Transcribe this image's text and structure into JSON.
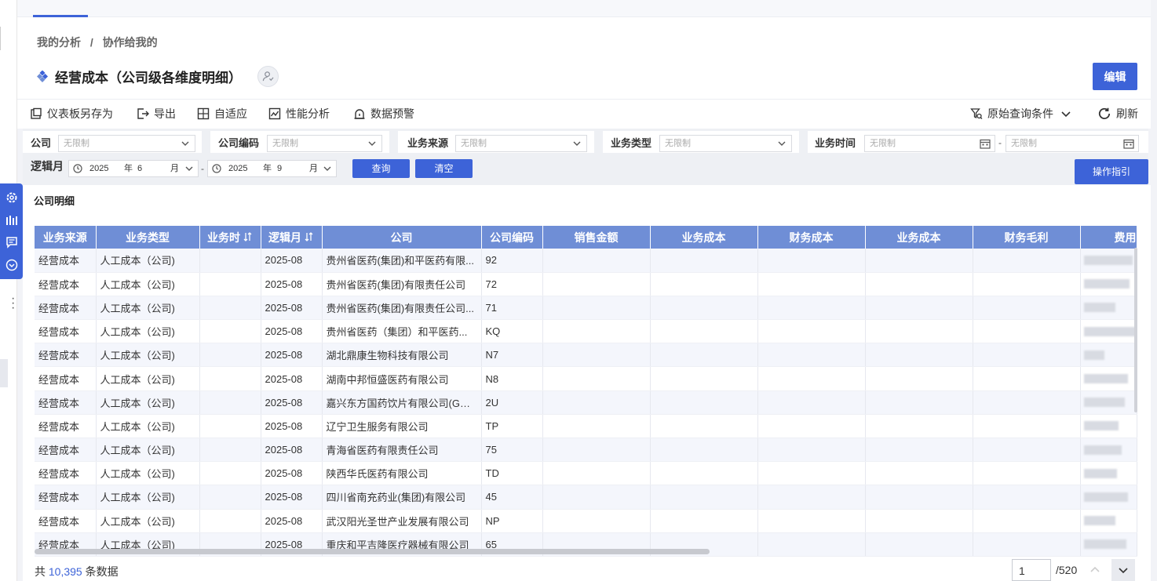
{
  "breadcrumb": {
    "root": "我的分析",
    "separator": "/",
    "current": "协作给我的"
  },
  "page_title": "经营成本（公司级各维度明细）",
  "edit_label": "编辑",
  "toolbar": {
    "save_as": "仪表板另存为",
    "export": "导出",
    "adaptive": "自适应",
    "performance": "性能分析",
    "alert": "数据预警",
    "original_query": "原始查询条件",
    "refresh": "刷新"
  },
  "filters": {
    "company": {
      "label": "公司",
      "value": "无限制"
    },
    "company_code": {
      "label": "公司编码",
      "value": "无限制"
    },
    "biz_source": {
      "label": "业务来源",
      "value": "无限制"
    },
    "biz_type": {
      "label": "业务类型",
      "value": "无限制"
    },
    "biz_time": {
      "label": "业务时间",
      "start": "无限制",
      "sep": "-",
      "end": "无限制"
    },
    "logic_month": {
      "label": "逻辑月",
      "start_year": "2025",
      "start_year_unit": "年",
      "start_month": "6",
      "start_month_unit": "月",
      "sep": "-",
      "end_year": "2025",
      "end_year_unit": "年",
      "end_month": "9",
      "end_month_unit": "月"
    },
    "query_label": "查询",
    "clear_label": "清空",
    "guide_label": "操作指引"
  },
  "panel_title": "公司明细",
  "table": {
    "columns": [
      "业务来源",
      "业务类型",
      "业务时",
      "逻辑月",
      "公司",
      "公司编码",
      "销售金额",
      "业务成本",
      "财务成本",
      "业务成本",
      "财务毛利",
      "费用"
    ],
    "rows": [
      [
        "经营成本",
        "人工成本（公司)",
        "",
        "2025-08",
        "贵州省医药(集团)和平医药有限...",
        "92"
      ],
      [
        "经营成本",
        "人工成本（公司)",
        "",
        "2025-08",
        "贵州省医药(集团)有限责任公司",
        "72"
      ],
      [
        "经营成本",
        "人工成本（公司)",
        "",
        "2025-08",
        "贵州省医药(集团)有限责任公司...",
        "71"
      ],
      [
        "经营成本",
        "人工成本（公司)",
        "",
        "2025-08",
        "贵州省医药（集团）和平医药...",
        "KQ"
      ],
      [
        "经营成本",
        "人工成本（公司)",
        "",
        "2025-08",
        "湖北鼎康生物科技有限公司",
        "N7"
      ],
      [
        "经营成本",
        "人工成本（公司)",
        "",
        "2025-08",
        "湖南中邦恒盛医药有限公司",
        "N8"
      ],
      [
        "经营成本",
        "人工成本（公司)",
        "",
        "2025-08",
        "嘉兴东方国药饮片有限公司(GSP)",
        "2U"
      ],
      [
        "经营成本",
        "人工成本（公司)",
        "",
        "2025-08",
        "辽宁卫生服务有限公司",
        "TP"
      ],
      [
        "经营成本",
        "人工成本（公司)",
        "",
        "2025-08",
        "青海省医药有限责任公司",
        "75"
      ],
      [
        "经营成本",
        "人工成本（公司)",
        "",
        "2025-08",
        "陕西华氏医药有限公司",
        "TD"
      ],
      [
        "经营成本",
        "人工成本（公司)",
        "",
        "2025-08",
        "四川省南充药业(集团)有限公司",
        "45"
      ],
      [
        "经营成本",
        "人工成本（公司)",
        "",
        "2025-08",
        "武汉阳光圣世产业发展有限公司",
        "NP"
      ],
      [
        "经营成本",
        "人工成本（公司)",
        "",
        "2025-08",
        "重庆和平吉隆医疗器械有限公司",
        "65"
      ]
    ]
  },
  "footer": {
    "prefix": "共",
    "total": "10,395",
    "suffix": "条数据",
    "page": "1",
    "total_pages": "/520"
  },
  "colors": {
    "accent": "#3d63d8",
    "header_bg": "#6f8ed6",
    "row_alt": "#f4f6fc"
  }
}
